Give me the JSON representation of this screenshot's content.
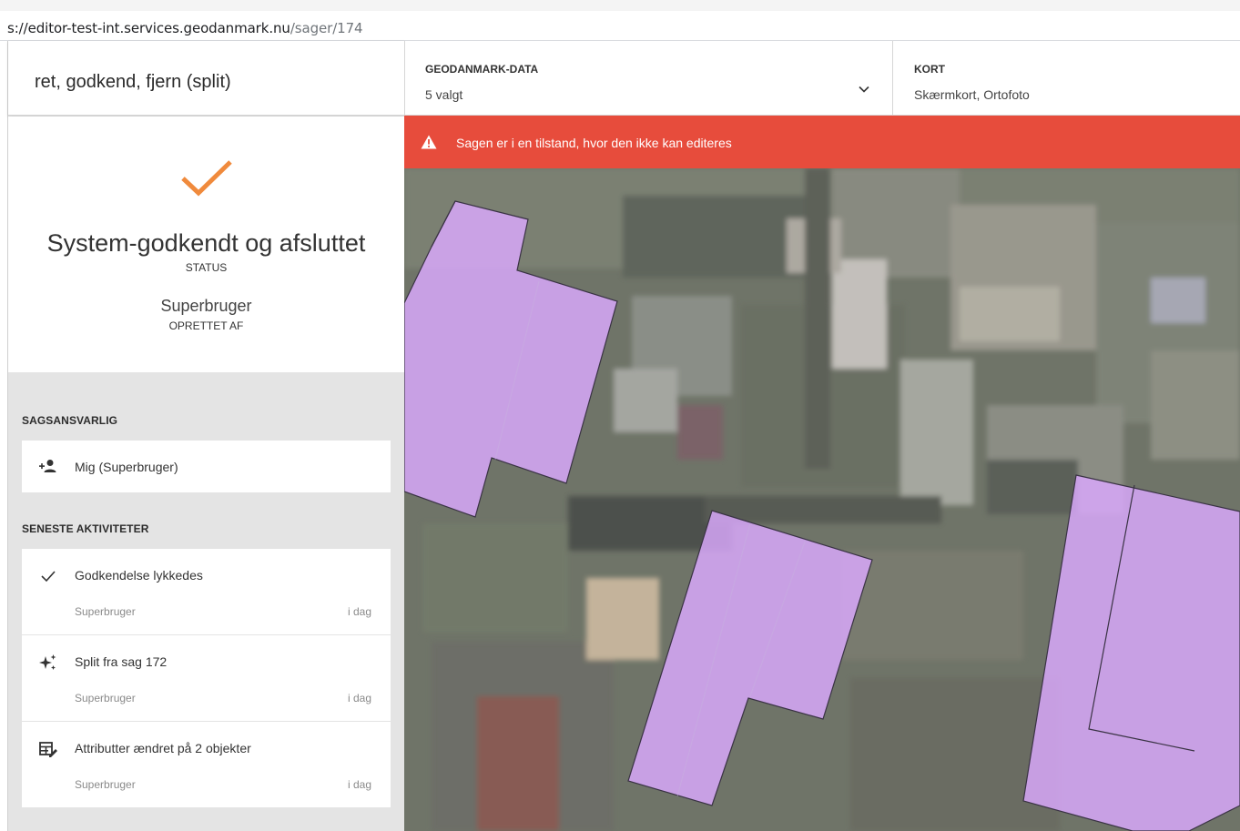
{
  "browser": {
    "url_domain": "s://editor-test-int.services.geodanmark.nu",
    "url_path": "/sager/174"
  },
  "sidebar": {
    "case_title": "ret, godkend, fjern (split)",
    "status": {
      "icon": "check-icon",
      "icon_color": "#f08a3c",
      "value": "System-godkendt og afsluttet",
      "label": "STATUS"
    },
    "creator": {
      "value": "Superbruger",
      "label": "OPRETTET AF"
    },
    "responsible_heading": "SAGSANSVARLIG",
    "responsible": {
      "icon": "person-add-icon",
      "name": "Mig (Superbruger)"
    },
    "activities_heading": "SENESTE AKTIVITETER",
    "activities": [
      {
        "icon": "check-icon",
        "title": "Godkendelse lykkedes",
        "user": "Superbruger",
        "time": "i dag"
      },
      {
        "icon": "sparkle-icon",
        "title": "Split fra sag 172",
        "user": "Superbruger",
        "time": "i dag"
      },
      {
        "icon": "table-edit-icon",
        "title": "Attributter ændret på 2 objekter",
        "user": "Superbruger",
        "time": "i dag"
      }
    ]
  },
  "topbar": {
    "data_panel": {
      "label": "GEODANMARK-DATA",
      "value": "5 valgt"
    },
    "map_panel": {
      "label": "KORT",
      "value": "Skærmkort, Ortofoto"
    }
  },
  "warning": {
    "icon": "warning-icon",
    "text": "Sagen er i en tilstand, hvor den ikke kan editeres",
    "color": "#e74c3c"
  },
  "map": {
    "background": "aerial orthophoto",
    "building_fill": "#dcaaff"
  }
}
